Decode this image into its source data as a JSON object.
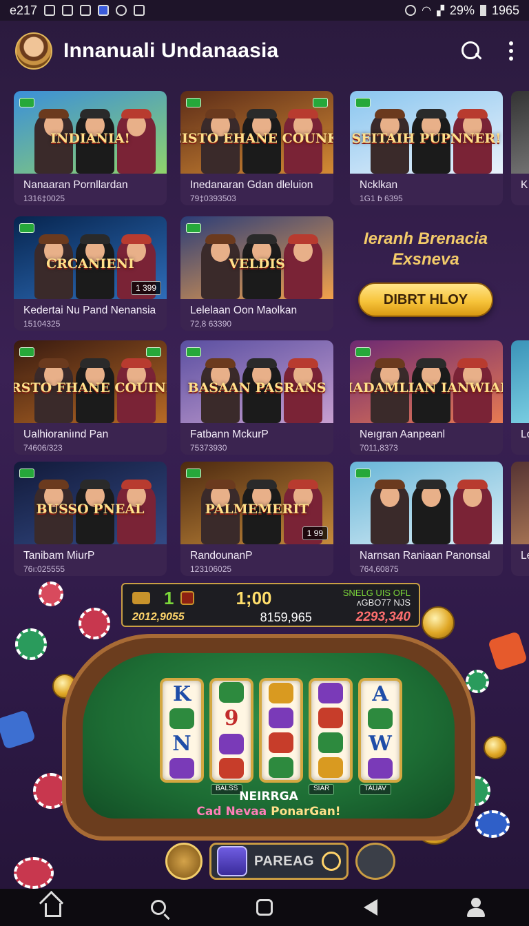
{
  "status_bar": {
    "time": "e217",
    "battery": "29%",
    "right_clock": "1965",
    "icons": [
      "sim-icon",
      "box-icon",
      "mail-icon",
      "app-icon",
      "sync-icon",
      "photo-icon",
      "alarm-icon",
      "wifi-icon",
      "signal-icon",
      "battery-icon"
    ]
  },
  "header": {
    "title": "Innanuali Undanaasia",
    "avatar": "avatar",
    "actions": [
      "search-icon",
      "more-vert-icon"
    ]
  },
  "rows": [
    {
      "cards": [
        {
          "title": "Nanaaran Pornllardan",
          "sub": "1316‡0025",
          "logo": "INDIANIA!",
          "logo_sub": "",
          "colors": [
            "#3b8fd9",
            "#8fd36b"
          ]
        },
        {
          "title": "Inedanaran Gdan dleluion",
          "sub": "79‡0393503",
          "logo": "JEISTO EHANE COUNKS",
          "logo_sub": "",
          "colors": [
            "#5c2c18",
            "#d38a34"
          ]
        },
        {
          "title": "Ncklkan",
          "sub": "1G1 ɓ 6395",
          "logo": "SEITAIH PUPNNER!",
          "logo_sub": "",
          "colors": [
            "#8ac6ef",
            "#e9f1fb"
          ]
        },
        {
          "title": "K",
          "sub": "",
          "logo": "",
          "logo_sub": "",
          "colors": [
            "#333",
            "#777"
          ]
        }
      ]
    },
    {
      "cards": [
        {
          "title": "Kedertai Nu Pand Nenansia",
          "sub": "15104325",
          "logo": "CRCANIENI",
          "logo_sub": "",
          "tag": "1 399",
          "colors": [
            "#07254f",
            "#2e6db9"
          ]
        },
        {
          "title": "Lelelaan Oon Maolkan",
          "sub": "72,8 63390",
          "logo": "VELDIS",
          "logo_sub": "",
          "colors": [
            "#2b3d78",
            "#f1a14b"
          ]
        }
      ],
      "promo": {
        "title": "Ieranh Brenacia Exsneva",
        "button": "DIBRT HLOY"
      }
    },
    {
      "cards": [
        {
          "title": "Ualhioraniınd Pan",
          "sub": "74606/323",
          "logo": "DRSTO FHANE COUINIS",
          "logo_sub": "",
          "colors": [
            "#381a10",
            "#b86a25"
          ]
        },
        {
          "title": "Fatbann MckurP",
          "sub": "75373930",
          "logo": "BASAAN PASRANS",
          "logo_sub": "",
          "colors": [
            "#5a4fa1",
            "#c79fd0"
          ]
        },
        {
          "title": "Neıgran Aanpeanl",
          "sub": "7011,8373",
          "logo": "HADAMLIAN IANWIAN",
          "logo_sub": "",
          "colors": [
            "#6e2a72",
            "#e77a52"
          ]
        },
        {
          "title": "Lo",
          "sub": "",
          "logo": "",
          "logo_sub": "",
          "colors": [
            "#3a93b8",
            "#7fd2e5"
          ]
        }
      ]
    },
    {
      "cards": [
        {
          "title": "Tanibam MiurP",
          "sub": "76ı:025555",
          "logo": "BUSSO PNEAL",
          "logo_sub": "",
          "colors": [
            "#121a3a",
            "#334a85"
          ]
        },
        {
          "title": "RandounanP",
          "sub": "123106025",
          "logo": "PALMEMERIT",
          "logo_sub": "",
          "tag": "1 99",
          "colors": [
            "#4d2a10",
            "#c58a3b"
          ]
        },
        {
          "title": "Narnsan Raniaan Panonsal",
          "sub": "764,60875",
          "logo": "",
          "logo_sub": "",
          "colors": [
            "#69b6d8",
            "#dbeef6"
          ]
        },
        {
          "title": "Le",
          "sub": "",
          "logo": "",
          "logo_sub": "",
          "colors": [
            "#533",
            "#a75"
          ]
        }
      ]
    }
  ],
  "hud": {
    "multiplier": "1",
    "big_value": "1;00",
    "label_top": "SNELG UIS OFL",
    "label_bottom": "ʌGBO77 NJS",
    "balance": "2012,9055",
    "center_value": "8159,965",
    "win_value": "2293,340"
  },
  "table": {
    "reels": [
      [
        "K",
        "",
        "N",
        ""
      ],
      [
        "",
        "9",
        "",
        ""
      ],
      [
        "",
        "",
        "",
        ""
      ],
      [
        "",
        "",
        "",
        ""
      ],
      [
        "A",
        "",
        "W",
        ""
      ]
    ],
    "mini_labels": [
      "BALSS",
      "SIAR",
      "TAUAV"
    ],
    "caption_line1": "NEIRRGA",
    "caption_line2_a": "Cad Nevaa",
    "caption_line2_b": "PonarGan!"
  },
  "controls": {
    "play_label": "PAREAG"
  },
  "nav": [
    "home-icon",
    "search-icon",
    "recents-icon",
    "back-icon",
    "profile-icon"
  ]
}
